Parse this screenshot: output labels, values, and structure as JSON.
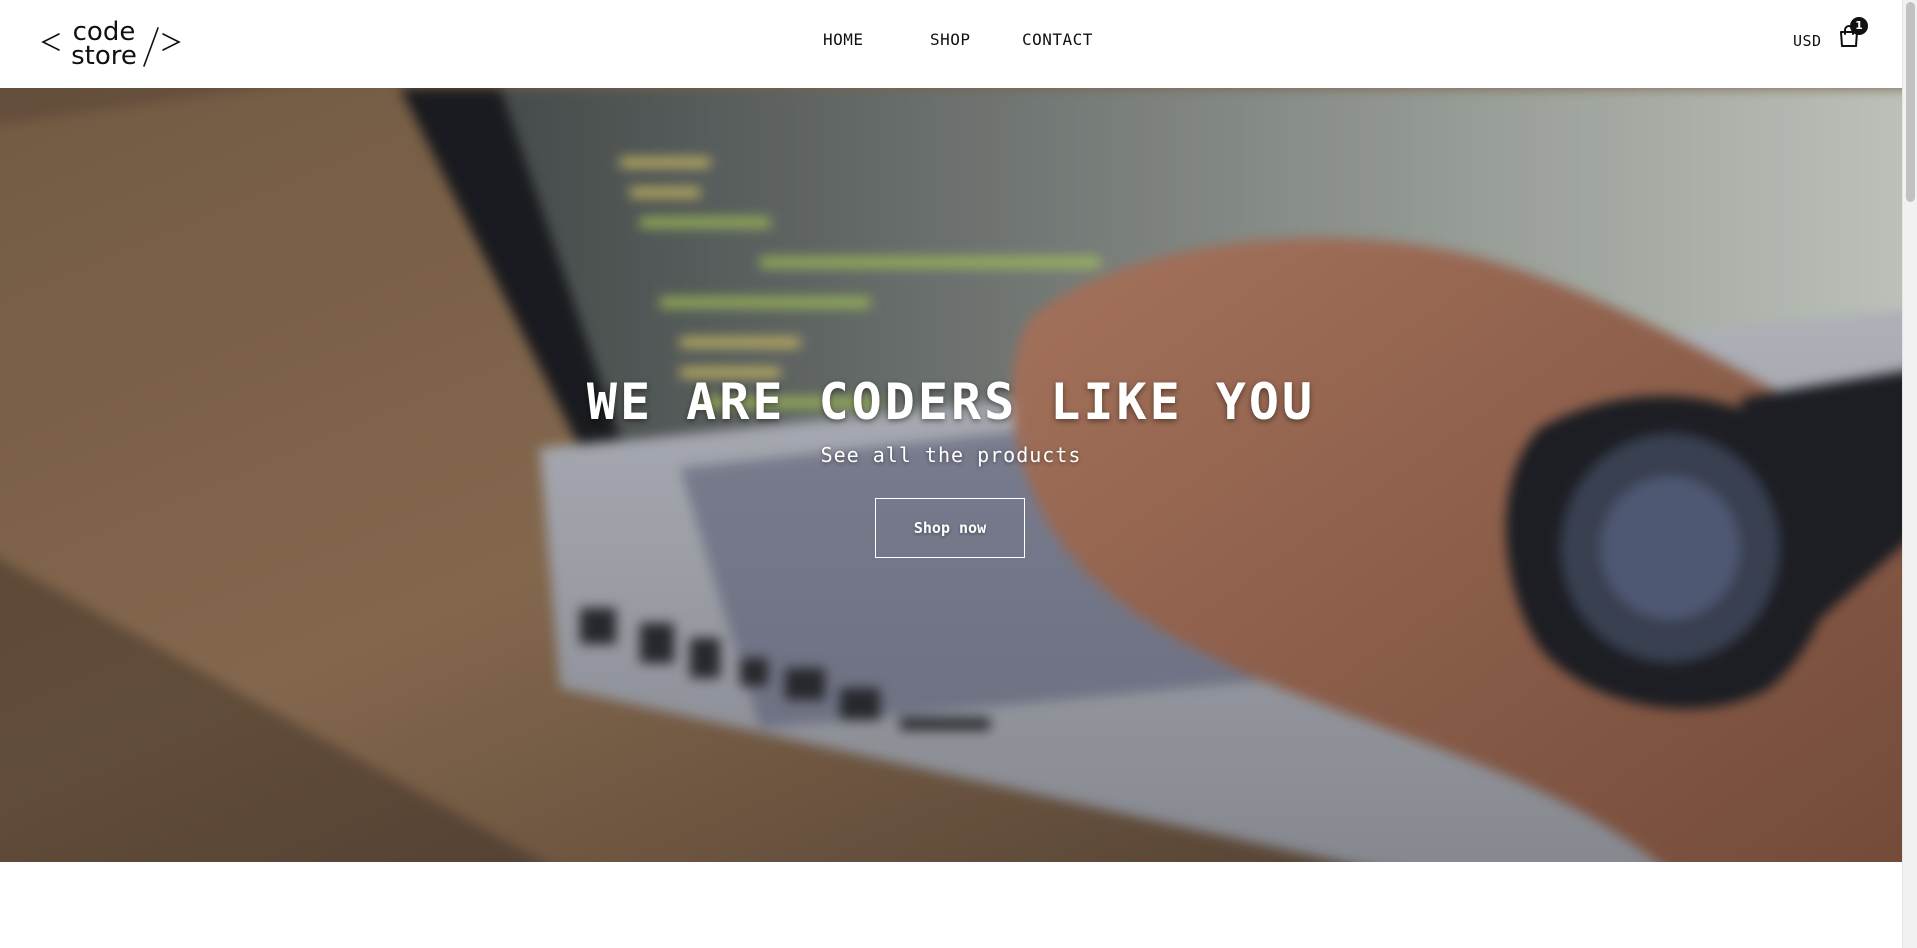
{
  "header": {
    "logo": {
      "line1": "code",
      "line2": "store",
      "left_bracket": "<",
      "right_bracket": "/>"
    },
    "nav": [
      {
        "label": "HOME"
      },
      {
        "label": "SHOP"
      },
      {
        "label": "CONTACT"
      }
    ],
    "currency": "USD",
    "cart": {
      "icon": "shopping-bag-icon",
      "count": "1"
    }
  },
  "hero": {
    "title": "WE ARE CODERS LIKE YOU",
    "subtitle": "See all the products",
    "button_label": "Shop now",
    "background": "blurred-photo-hands-typing-on-laptop"
  },
  "colors": {
    "text": "#111111",
    "badge": "#111111",
    "hero_text": "#ffffff"
  }
}
